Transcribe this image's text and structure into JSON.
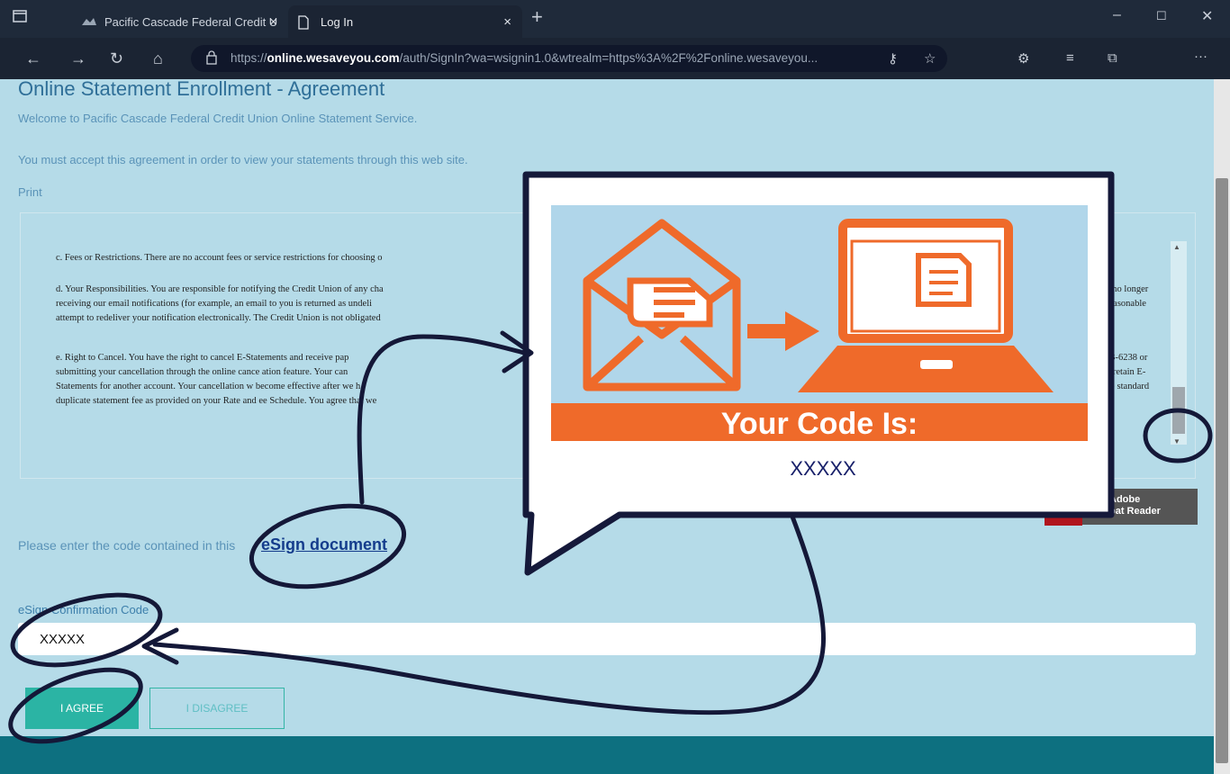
{
  "browser": {
    "tabs": [
      {
        "label": "Pacific Cascade Federal Credit U",
        "active": false
      },
      {
        "label": "Log In",
        "active": true
      }
    ],
    "tab_close": "×",
    "new_tab": "+",
    "url_prefix": "https://",
    "url_host": "online.wesaveyou.com",
    "url_path": "/auth/SignIn?wa=wsignin1.0&wtrealm=https%3A%2F%2Fonline.wesaveyou...",
    "window_controls": [
      "–",
      "☐",
      "✕"
    ]
  },
  "page": {
    "title": "Online Statement Enrollment - Agreement",
    "welcome": "Welcome to Pacific Cascade Federal Credit Union Online Statement Service.",
    "must_accept": "You must accept this agreement in order to view your statements through this web site.",
    "print_link": "Print",
    "document": {
      "para_c": "c. Fees or Restrictions. There are no account fees or service restrictions for choosing o",
      "para_d": "d. Your Responsibilities. You are responsible for notifying the Credit Union of any cha",
      "para_d2": "receiving our email notifications (for example, an email to you is returned as undeli",
      "para_d3": "attempt to redeliver your notification electronically. The Credit Union is not obligated",
      "para_d_right": "e no longer",
      "para_d2_right": "reasonable",
      "para_e": "e. Right to Cancel. You have the right to cancel E-Statements and receive pap",
      "para_e2": "submitting your cancellation through the online cance ation feature. Your can",
      "para_e3": "Statements for another account.  Your cancellation w  become effective after we h",
      "para_e4": "duplicate statement fee as provided on your Rate and  ee Schedule. You agree that we",
      "para_e_right": "43-6238 or",
      "para_e2_right": "d retain E-",
      "para_e3_right": "he standard"
    },
    "acrobat": "Adobe\nbat Reader",
    "enter_code_text": "Please enter the code contained in this",
    "esign_link": "eSign document",
    "code_label": "eSign Confirmation Code",
    "code_value": "XXXXX",
    "agree_label": "I AGREE",
    "disagree_label": "I DISAGREE"
  },
  "popup": {
    "banner": "Your Code Is:",
    "code": "XXXXX"
  },
  "colors": {
    "page_bg": "#b5dbe8",
    "accent_teal": "#2bb4a4",
    "illustration_orange": "#ef6a2a",
    "annotation_ink": "#141838"
  },
  "icons": [
    "window-icon",
    "favicon-icon",
    "page-icon",
    "back-icon",
    "forward-icon",
    "refresh-icon",
    "home-icon",
    "lock-icon",
    "key-icon",
    "favorite-add-icon",
    "extension-icon",
    "favorites-icon",
    "collections-icon",
    "more-icon",
    "envelope-icon",
    "laptop-icon",
    "arrow-icon"
  ]
}
